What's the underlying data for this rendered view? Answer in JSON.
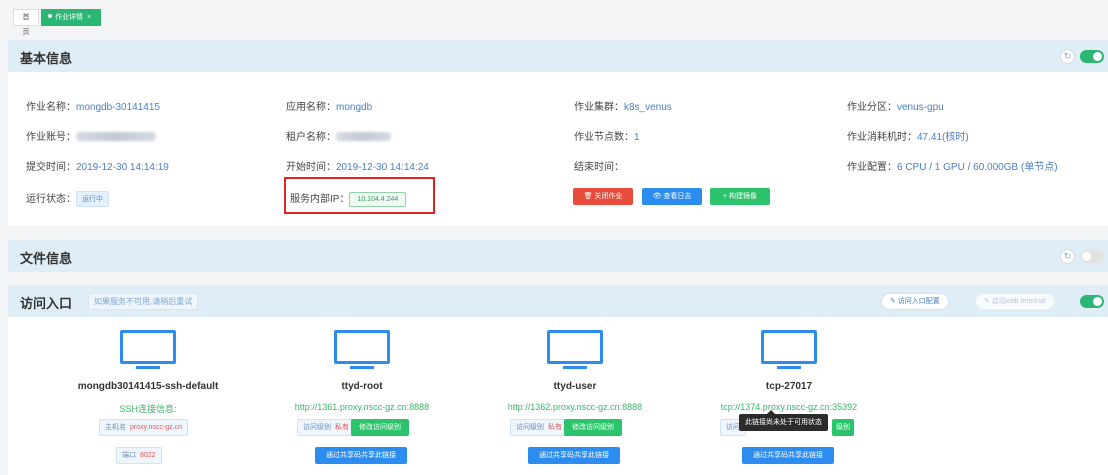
{
  "tabs": [
    {
      "label": "首页"
    },
    {
      "label": "作业详情",
      "close": "×"
    }
  ],
  "basic": {
    "title": "基本信息",
    "refresh_icon": "refresh-icon",
    "fields": {
      "job_name": {
        "key": "作业名称：",
        "value": "mongdb-30141415"
      },
      "app_name": {
        "key": "应用名称：",
        "value": "mongdb"
      },
      "cluster": {
        "key": "作业集群：",
        "value": "k8s_venus"
      },
      "partition": {
        "key": "作业分区：",
        "value": "venus-gpu"
      },
      "account": {
        "key": "作业账号："
      },
      "tenant": {
        "key": "租户名称："
      },
      "nodes": {
        "key": "作业节点数：",
        "value": "1"
      },
      "core_hours": {
        "key": "作业消耗机时：",
        "value": "47.41(核时)"
      },
      "submit_time": {
        "key": "提交时间：",
        "value": "2019-12-30 14:14:19"
      },
      "start_time": {
        "key": "开始时间：",
        "value": "2019-12-30 14:14:24"
      },
      "end_time": {
        "key": "结束时间：",
        "value": ""
      },
      "config": {
        "key": "作业配置：",
        "value": "6 CPU / 1 GPU / 60.000GB (单节点)"
      },
      "status": {
        "key": "运行状态：",
        "value": "运行中"
      },
      "service_ip": {
        "key": "服务内部IP：",
        "value": "10.104.4.244"
      }
    },
    "buttons": {
      "stop": "关闭作业",
      "log": "查看日志",
      "image": "构建镜像"
    }
  },
  "files": {
    "title": "文件信息"
  },
  "access": {
    "title": "访问入口",
    "hint": "如果服务不可用,请稍后重试",
    "config_btn": "访问入口配置",
    "web_terminal_btn": "启动web terminal",
    "tooltip": "此链接尚未处于可用状态",
    "cards": [
      {
        "name": "mongdb30141415-ssh-default",
        "link": "SSH连接信息:",
        "chip1_k": "主机名",
        "chip1_v": "proxy.nscc-gz.cn",
        "chip2_k": "端口",
        "chip2_v": "8022"
      },
      {
        "name": "ttyd-root",
        "link": "http://1361.proxy.nscc-gz.cn:8888",
        "chip_k": "访问级别",
        "chip_v": "私有",
        "modify": "修改访问级别",
        "share": "通过共享码共享此链接"
      },
      {
        "name": "ttyd-user",
        "link": "http://1362.proxy.nscc-gz.cn:8888",
        "chip_k": "访问级别",
        "chip_v": "私有",
        "modify": "修改访问级别",
        "share": "通过共享码共享此链接"
      },
      {
        "name": "tcp-27017",
        "link": "tcp://1374.proxy.nscc-gz.cn:35392",
        "chip_k": "访问",
        "modify": "级别",
        "share": "通过共享码共享此链接"
      }
    ]
  },
  "colors": {
    "accent": "#2bb673",
    "primary": "#2d8cf0",
    "danger": "#e74c3c",
    "highlight_box": "#e02424"
  }
}
